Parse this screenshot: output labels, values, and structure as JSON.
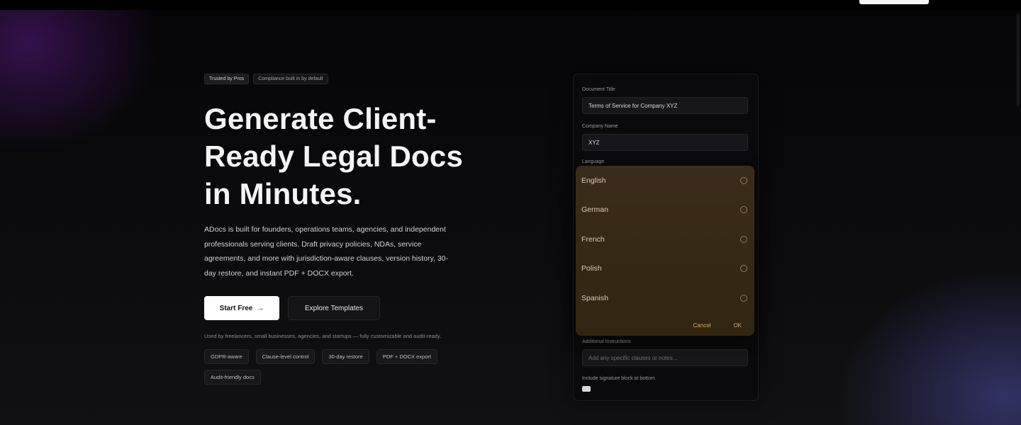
{
  "topbar": {
    "cta_label": ""
  },
  "hero": {
    "badges": [
      "Trusted by Pros",
      "Compliance built in by default"
    ],
    "headline": "Generate Client-Ready Legal Docs in Minutes.",
    "lead": "ADocs is built for founders, operations teams, agencies, and independent professionals serving clients. Draft privacy policies, NDAs, service agreements, and more with jurisdiction-aware clauses, version history, 30-day restore, and instant PDF + DOCX export.",
    "primary_cta": "Start Free",
    "primary_cta_arrow": "→",
    "secondary_cta": "Explore Templates",
    "trust_line": "Used by freelancers, small businesses, agencies, and startups — fully customizable and audit-ready.",
    "chips": [
      "GDPR-aware",
      "Clause-level control",
      "30-day restore",
      "PDF + DOCX export",
      "Audit-friendly docs"
    ]
  },
  "form": {
    "fields": [
      {
        "label": "Document Title",
        "value": "Terms of Service for Company XYZ",
        "placeholder": ""
      },
      {
        "label": "Company Name",
        "value": "XYZ",
        "placeholder": ""
      }
    ],
    "language_label": "Language",
    "extra_label": "Additional Instructions",
    "extra_placeholder": "Add any specific clauses or notes...",
    "checkbox_label": "Include signature block at bottom"
  },
  "dropdown": {
    "options": [
      "English",
      "German",
      "French",
      "Polish",
      "Spanish"
    ],
    "cancel": "Cancel",
    "ok": "OK"
  },
  "colors": {
    "background": "#070709",
    "dropdown": "#3a2c1a",
    "accent_text": "#c9a96e",
    "primary_button": "#ffffff"
  }
}
